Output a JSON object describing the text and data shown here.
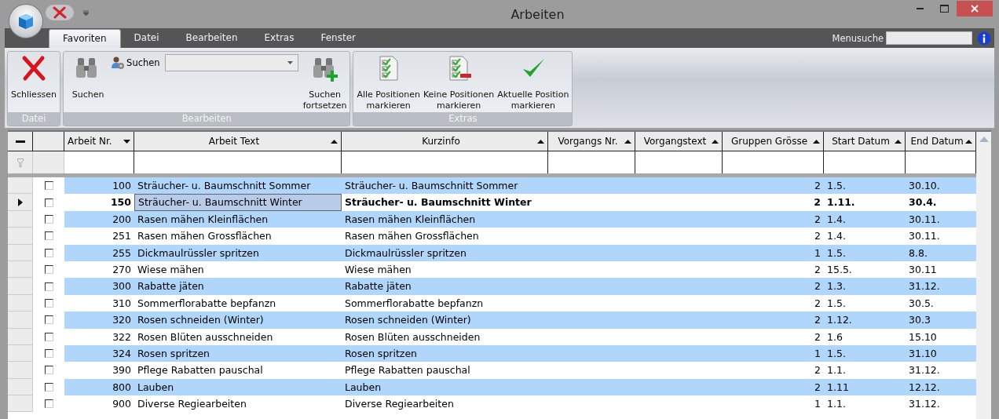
{
  "window": {
    "title": "Arbeiten"
  },
  "tabs": [
    {
      "label": "Favoriten",
      "selected": true
    },
    {
      "label": "Datei",
      "selected": false
    },
    {
      "label": "Bearbeiten",
      "selected": false
    },
    {
      "label": "Extras",
      "selected": false
    },
    {
      "label": "Fenster",
      "selected": false
    }
  ],
  "menu_search": {
    "label": "Menusuche"
  },
  "ribbon_groups": [
    {
      "label": "Datei",
      "items": [
        {
          "kind": "close",
          "lines": [
            "Schliessen"
          ]
        }
      ]
    },
    {
      "label": "Bearbeiten",
      "items": [
        {
          "kind": "find",
          "lines": [
            "Suchen"
          ]
        },
        {
          "kind": "combo",
          "label": "Suchen"
        },
        {
          "kind": "find_next",
          "lines": [
            "Suchen",
            "fortsetzen"
          ]
        }
      ]
    },
    {
      "label": "Extras",
      "items": [
        {
          "kind": "mark_all",
          "lines": [
            "Alle Positionen",
            "markieren"
          ]
        },
        {
          "kind": "mark_none",
          "lines": [
            "Keine Positionen",
            "markieren"
          ]
        },
        {
          "kind": "mark_current",
          "lines": [
            "Aktuelle Position",
            "markieren"
          ]
        }
      ]
    }
  ],
  "grid": {
    "columns": [
      {
        "label": "Arbeit Nr.",
        "descending": true
      },
      {
        "label": "Arbeit Text",
        "descending": false
      },
      {
        "label": "Kurzinfo",
        "descending": false
      },
      {
        "label": "Vorgangs Nr.",
        "descending": false
      },
      {
        "label": "Vorgangstext",
        "descending": false
      },
      {
        "label": "Gruppen Grösse",
        "descending": false
      },
      {
        "label": "Start Datum",
        "descending": false
      },
      {
        "label": "End Datum",
        "descending": false
      }
    ],
    "rows": [
      {
        "checked": false,
        "current": false,
        "nr": "100",
        "arbeit_text": "Sträucher- u. Baumschnitt Sommer",
        "kurzinfo": "Sträucher- u. Baumschnitt Sommer",
        "gruppen_groesse": "2",
        "start_datum": "1.5.",
        "end_datum": "30.10."
      },
      {
        "checked": false,
        "current": true,
        "nr": "150",
        "arbeit_text": "Sträucher- u. Baumschnitt Winter",
        "kurzinfo": "Sträucher- u. Baumschnitt Winter",
        "gruppen_groesse": "2",
        "start_datum": "1.11.",
        "end_datum": "30.4."
      },
      {
        "checked": false,
        "current": false,
        "nr": "200",
        "arbeit_text": "Rasen mähen Kleinflächen",
        "kurzinfo": "Rasen mähen Kleinflächen",
        "gruppen_groesse": "2",
        "start_datum": "1.4.",
        "end_datum": "30.11."
      },
      {
        "checked": false,
        "current": false,
        "nr": "251",
        "arbeit_text": "Rasen mähen Grossflächen",
        "kurzinfo": "Rasen mähen Grossflächen",
        "gruppen_groesse": "2",
        "start_datum": "1.4.",
        "end_datum": "30.11."
      },
      {
        "checked": false,
        "current": false,
        "nr": "255",
        "arbeit_text": "Dickmaulrüssler spritzen",
        "kurzinfo": "Dickmaulrüssler spritzen",
        "gruppen_groesse": "1",
        "start_datum": "1.5.",
        "end_datum": "8.8."
      },
      {
        "checked": false,
        "current": false,
        "nr": "270",
        "arbeit_text": "Wiese mähen",
        "kurzinfo": "Wiese mähen",
        "gruppen_groesse": "2",
        "start_datum": "15.5.",
        "end_datum": "30.11"
      },
      {
        "checked": false,
        "current": false,
        "nr": "300",
        "arbeit_text": "Rabatte jäten",
        "kurzinfo": "Rabatte jäten",
        "gruppen_groesse": "2",
        "start_datum": "1.3.",
        "end_datum": "31.12."
      },
      {
        "checked": false,
        "current": false,
        "nr": "310",
        "arbeit_text": "Sommerflorabatte bepfanzn",
        "kurzinfo": "Sommerflorabatte bepfanzn",
        "gruppen_groesse": "2",
        "start_datum": "1.5.",
        "end_datum": "30.5."
      },
      {
        "checked": false,
        "current": false,
        "nr": "320",
        "arbeit_text": "Rosen schneiden (Winter)",
        "kurzinfo": "Rosen schneiden (Winter)",
        "gruppen_groesse": "2",
        "start_datum": "1.12.",
        "end_datum": "30.3"
      },
      {
        "checked": false,
        "current": false,
        "nr": "322",
        "arbeit_text": "Rosen Blüten ausschneiden",
        "kurzinfo": "Rosen Blüten ausschneiden",
        "gruppen_groesse": "2",
        "start_datum": "1.6",
        "end_datum": "15.10"
      },
      {
        "checked": false,
        "current": false,
        "nr": "324",
        "arbeit_text": "Rosen spritzen",
        "kurzinfo": "Rosen spritzen",
        "gruppen_groesse": "1",
        "start_datum": "1.5.",
        "end_datum": "31.10"
      },
      {
        "checked": false,
        "current": false,
        "nr": "390",
        "arbeit_text": "Pflege Rabatten pauschal",
        "kurzinfo": "Pflege Rabatten pauschal",
        "gruppen_groesse": "2",
        "start_datum": "1.1.",
        "end_datum": "31.12."
      },
      {
        "checked": false,
        "current": false,
        "nr": "800",
        "arbeit_text": "Lauben",
        "kurzinfo": "Lauben",
        "gruppen_groesse": "2",
        "start_datum": "1.11",
        "end_datum": "12.12."
      },
      {
        "checked": false,
        "current": false,
        "nr": "900",
        "arbeit_text": "Diverse Regiearbeiten",
        "kurzinfo": "Diverse Regiearbeiten",
        "gruppen_groesse": "1",
        "start_datum": "1.1.",
        "end_datum": "31.12."
      }
    ]
  }
}
